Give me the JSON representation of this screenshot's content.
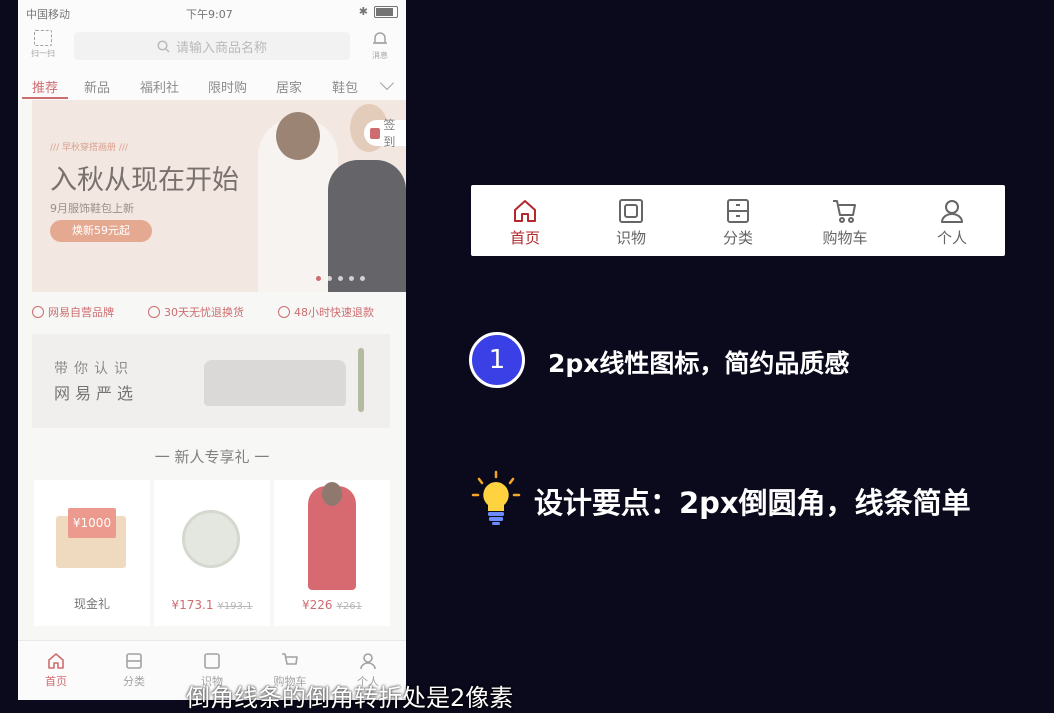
{
  "phone": {
    "status": {
      "carrier": "中国移动",
      "time": "下午9:07"
    },
    "scan_label": "扫一扫",
    "search_placeholder": "请输入商品名称",
    "message_label": "消息",
    "tabs": [
      "推荐",
      "新品",
      "福利社",
      "限时购",
      "居家",
      "鞋包"
    ],
    "banner": {
      "tag": "/// 早秋穿搭画册 ///",
      "headline": "入秋从现在开始",
      "sub": "9月服饰鞋包上新",
      "button": "焕新59元起"
    },
    "checkin": "签到",
    "promises": [
      "网易自营品牌",
      "30天无忧退换货",
      "48小时快速退款"
    ],
    "about": {
      "line1": "带你认识",
      "line2": "网易严选"
    },
    "new_title": "一 新人专享礼 一",
    "gifts": [
      {
        "label": "现金礼",
        "card": "¥1000"
      },
      {
        "price": "¥173.1",
        "old": "¥193.1"
      },
      {
        "price": "¥226",
        "old": "¥261"
      }
    ],
    "tabbar": [
      "首页",
      "分类",
      "识物",
      "购物车",
      "个人"
    ]
  },
  "demo_tabbar": [
    "首页",
    "识物",
    "分类",
    "购物车",
    "个人"
  ],
  "point1": {
    "number": "1",
    "text": "2px线性图标，简约品质感"
  },
  "point2": {
    "text": "设计要点：2px倒圆角，线条简单"
  },
  "subtitle": "倒角线条的倒角转折处是2像素",
  "colors": {
    "accent": "#b4282d",
    "bg": "#0b0a1c",
    "badge": "#3b40e6"
  }
}
